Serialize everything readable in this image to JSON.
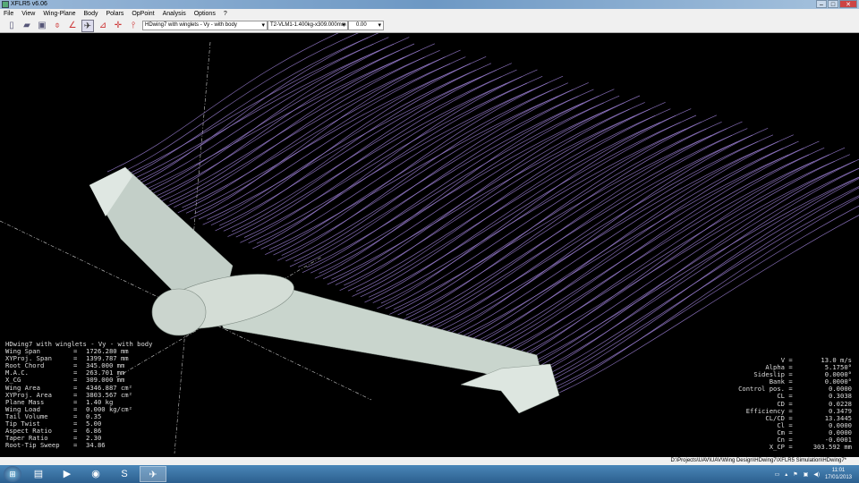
{
  "window": {
    "title": "XFLR5 v6.06"
  },
  "menu": [
    "File",
    "View",
    "Wing-Plane",
    "Body",
    "Polars",
    "OpPoint",
    "Analysis",
    "Options",
    "?"
  ],
  "toolbar": {
    "plane_select": "HDwing7 with winglets - Vy - with body",
    "polar_select": "T2-VLM1-1.400kg-x309.000mm",
    "opp_select": "0.00"
  },
  "left_info": {
    "title": "HDwing7 with winglets - Vy - with body",
    "rows": [
      [
        "Wing Span",
        "=",
        "1726.280 mm"
      ],
      [
        "XYProj. Span",
        "=",
        "1399.787 mm"
      ],
      [
        "Root Chord",
        "=",
        "345.000 mm"
      ],
      [
        "M.A.C.",
        "=",
        "263.701 mm"
      ],
      [
        "X_CG",
        "=",
        "309.000 mm"
      ],
      [
        "Wing Area",
        "=",
        "4346.887 cm²"
      ],
      [
        "XYProj. Area",
        "=",
        "3803.567 cm²"
      ],
      [
        "Plane Mass",
        "=",
        "1.40 kg"
      ],
      [
        "Wing Load",
        "=",
        "0.000 kg/cm²"
      ],
      [
        "Tail Volume",
        "=",
        "0.35"
      ],
      [
        "Tip Twist",
        "=",
        "5.00"
      ],
      [
        "Aspect Ratio",
        "=",
        "6.86"
      ],
      [
        "Taper Ratio",
        "=",
        "2.30"
      ],
      [
        "Root-Tip Sweep",
        "=",
        "34.86"
      ]
    ]
  },
  "right_info": [
    [
      "V",
      "13.0 m/s"
    ],
    [
      "Alpha",
      "5.1750°"
    ],
    [
      "Sideslip",
      "0.0000°"
    ],
    [
      "Bank",
      "0.0000°"
    ],
    [
      "Control pos.",
      "0.0000"
    ],
    [
      "CL",
      "0.3038"
    ],
    [
      "CD",
      "0.0228"
    ],
    [
      "Efficiency",
      "0.3479"
    ],
    [
      "CL/CD",
      "13.3445"
    ],
    [
      "Cl",
      "0.0000"
    ],
    [
      "Cm",
      "0.0000"
    ],
    [
      "Cn",
      "-0.0001"
    ],
    [
      "X_CP",
      "303.592 mm"
    ]
  ],
  "status": {
    "path": "D:\\Projects\\UAV\\UAV\\Wing Design\\HDwing7\\XFLR5 Simulation\\HDwing7*"
  },
  "taskbar": {
    "time": "11:01",
    "date": "17/01/2013"
  },
  "colors": {
    "streamline": "#9b7fd4",
    "wing": "#c8d4cc"
  }
}
